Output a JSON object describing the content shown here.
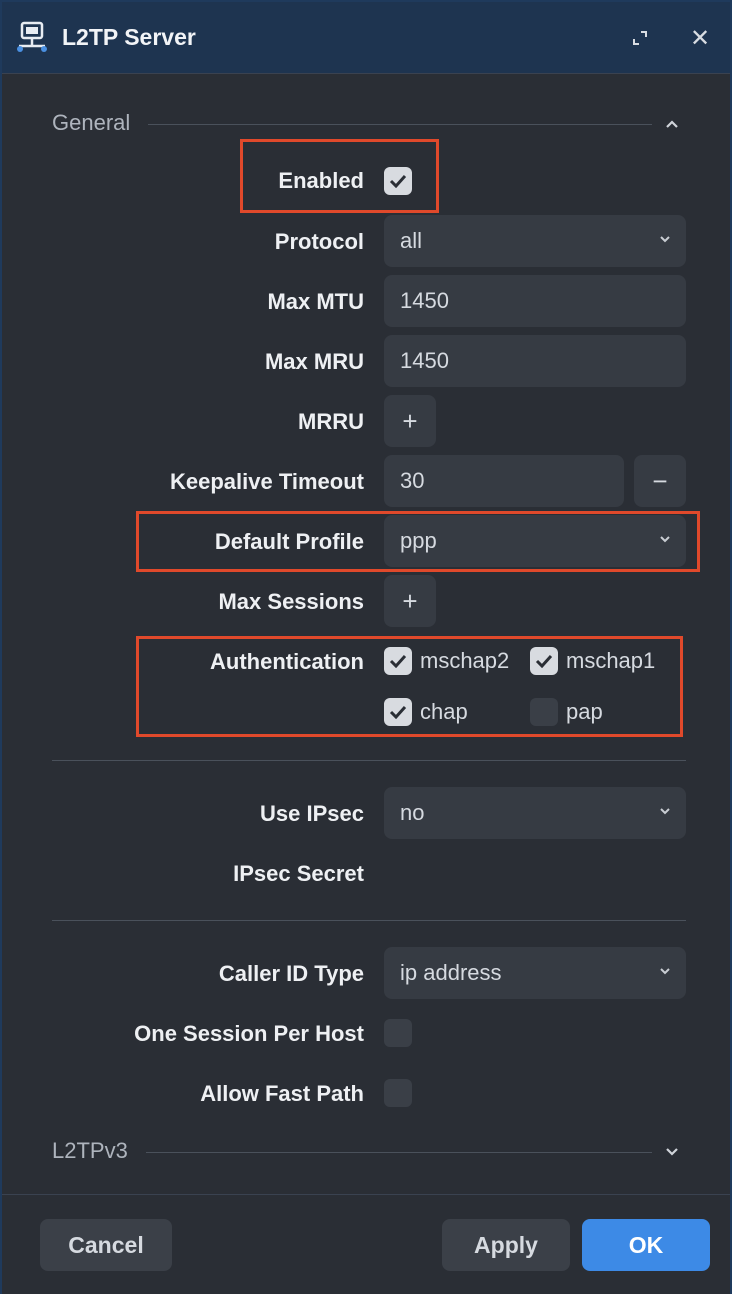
{
  "window": {
    "title": "L2TP Server",
    "icons": {
      "app": "network-icon",
      "maximize": "maximize-icon",
      "close": "close-icon"
    },
    "close_glyph": "✕"
  },
  "sections": {
    "general": "General",
    "l2tpv3": "L2TPv3"
  },
  "fields": {
    "enabled": {
      "label": "Enabled",
      "checked": true
    },
    "protocol": {
      "label": "Protocol",
      "value": "all"
    },
    "max_mtu": {
      "label": "Max MTU",
      "value": "1450"
    },
    "max_mru": {
      "label": "Max MRU",
      "value": "1450"
    },
    "mrru": {
      "label": "MRRU",
      "button": "+"
    },
    "keepalive_timeout": {
      "label": "Keepalive Timeout",
      "value": "30",
      "button": "−"
    },
    "default_profile": {
      "label": "Default Profile",
      "value": "ppp"
    },
    "max_sessions": {
      "label": "Max Sessions",
      "button": "+"
    },
    "authentication": {
      "label": "Authentication",
      "options": [
        {
          "name": "mschap2",
          "checked": true
        },
        {
          "name": "mschap1",
          "checked": true
        },
        {
          "name": "chap",
          "checked": true
        },
        {
          "name": "pap",
          "checked": false
        }
      ]
    },
    "use_ipsec": {
      "label": "Use IPsec",
      "value": "no"
    },
    "ipsec_secret": {
      "label": "IPsec Secret"
    },
    "caller_id_type": {
      "label": "Caller ID Type",
      "value": "ip address"
    },
    "one_session_per_host": {
      "label": "One Session Per Host",
      "checked": false
    },
    "allow_fast_path": {
      "label": "Allow Fast Path",
      "checked": false
    }
  },
  "footer": {
    "cancel": "Cancel",
    "apply": "Apply",
    "ok": "OK"
  },
  "colors": {
    "titlebar": "#1e3450",
    "highlight": "#e0492b",
    "primary": "#3d8ae6"
  }
}
